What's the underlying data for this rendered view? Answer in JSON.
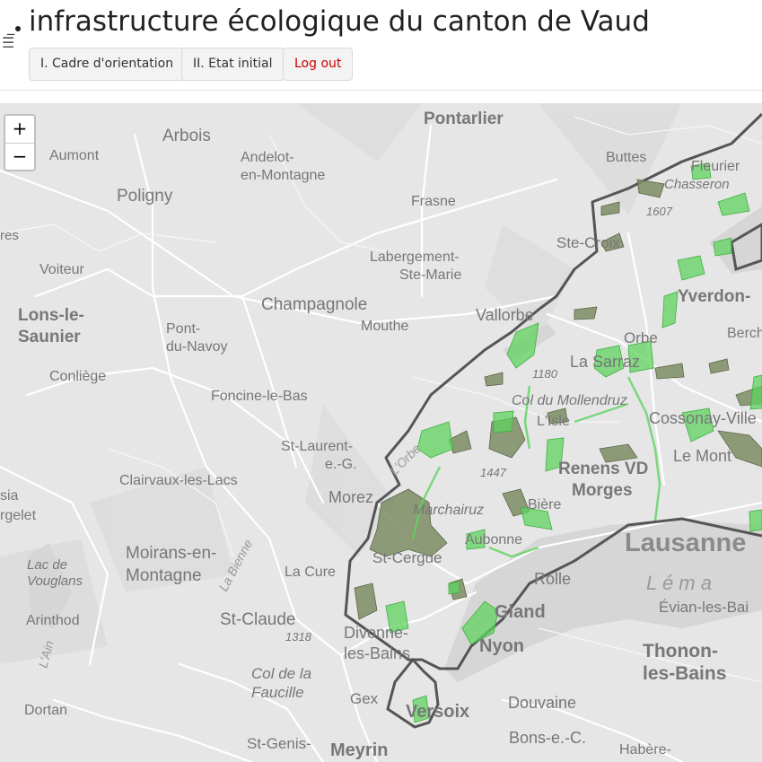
{
  "header": {
    "title": "infrastructure écologique du canton de Vaud",
    "buttons": {
      "cadre": "I. Cadre d'orientation",
      "etat": "II. Etat initial",
      "logout": "Log out"
    }
  },
  "map": {
    "zoom_in": "+",
    "zoom_out": "−",
    "colors": {
      "background": "#e6e6e6",
      "canton_border": "#555555",
      "green_area": "#5fd35f",
      "olive_area": "#7d8c63"
    },
    "places": {
      "pontarlier": "Pontarlier",
      "arbois": "Arbois",
      "aumont": "Aumont",
      "andelot": "Andelot-",
      "andelot2": "en-Montagne",
      "poligny": "Poligny",
      "frasne": "Frasne",
      "buttes": "Buttes",
      "fleurier": "Fleurier",
      "chasseron": "Chasseron",
      "stecroix": "Ste-Croix",
      "yverdon": "Yverdon-",
      "berch": "Berch",
      "voiteur": "Voiteur",
      "labergement": "Labergement-",
      "labergement2": "Ste-Marie",
      "lons": "Lons-le-",
      "lons2": "Saunier",
      "champagnole": "Champagnole",
      "vallorbe": "Vallorbe",
      "mouthe": "Mouthe",
      "orbe": "Orbe",
      "pontnavoy": "Pont-",
      "pontnavoy2": "du-Navoy",
      "conliege": "Conliège",
      "lasarraz": "La Sarraz",
      "foncine": "Foncine-le-Bas",
      "cossonay": "Cossonay-Ville",
      "lemont": "Le Mont",
      "stlaurent": "St-Laurent-",
      "stlaurent2": "e.-G.",
      "renens": "Renens VD",
      "morges": "Morges",
      "clairvaux": "Clairvaux-les-Lacs",
      "morez": "Morez",
      "lausanne": "Lausanne",
      "moirans": "Moirans-en-",
      "moirans2": "Montagne",
      "lacure": "La Cure",
      "stcergue": "St-Cergue",
      "aubonne": "Aubonne",
      "rolle": "Rolle",
      "leman": "L é m a",
      "evian": "Évian-les-Bai",
      "lacvouglans": "Lac de",
      "lacvouglans2": "Vouglans",
      "arinthod": "Arinthod",
      "stclaude": "St-Claude",
      "gland": "Gland",
      "nyon": "Nyon",
      "thonon": "Thonon-",
      "thonon2": "les-Bains",
      "divonne": "Divonne-",
      "divonne2": "les-Bains",
      "colfaucille": "Col de la",
      "colfaucille2": "Faucille",
      "gex": "Gex",
      "versoix": "Versoix",
      "douvaine": "Douvaine",
      "dortan": "Dortan",
      "stgenis": "St-Genis-",
      "meyrin": "Meyrin",
      "bonsc": "Bons-e.-C.",
      "habere": "Habère-",
      "marchairuz": "Marchairuz",
      "colmollendruz": "Col du Mollendruz",
      "lisle": "L'Isle",
      "biere": "Bière",
      "sia": "sia",
      "rgelet": "rgelet",
      "res": "res",
      "num1318": "1318",
      "num1180": "1180",
      "num1447": "1447",
      "num1607": "1607",
      "labienne": "La Bienne",
      "lain": "L'Ain",
      "lorbe": "L'Orbe"
    }
  }
}
